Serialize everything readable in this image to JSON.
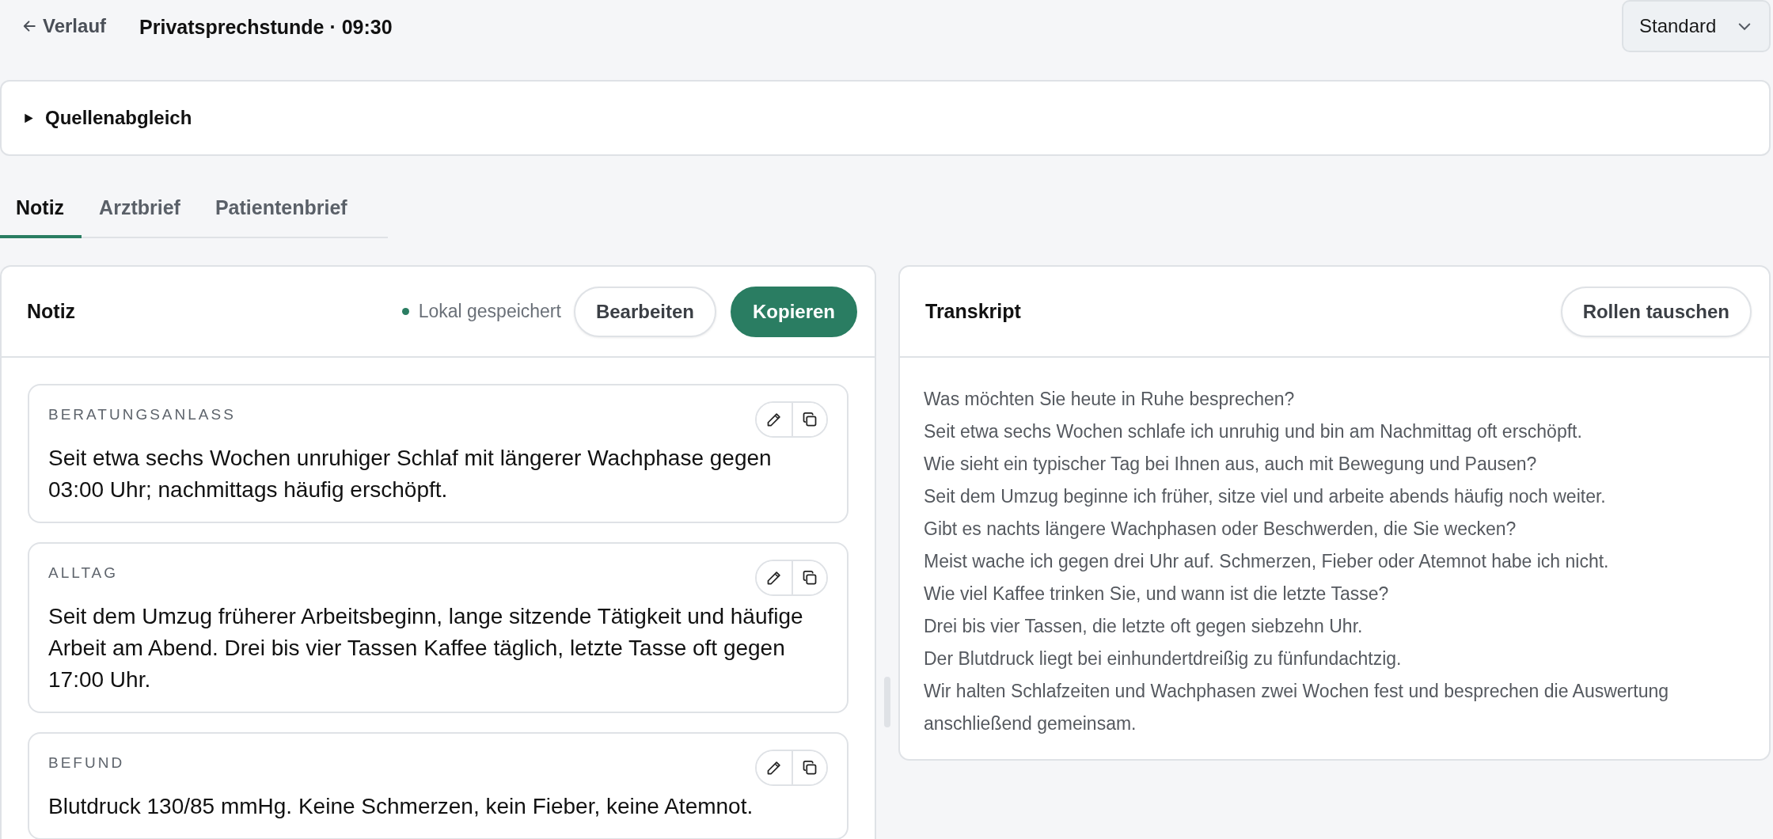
{
  "header": {
    "back_link": "Verlauf",
    "title": "Privatsprechstunde · 09:30",
    "mode_select": "Standard"
  },
  "source_check": {
    "label": "Quellenabgleich",
    "expanded": false
  },
  "tabs": [
    {
      "label": "Notiz",
      "selected": true
    },
    {
      "label": "Arztbrief",
      "selected": false
    },
    {
      "label": "Patientenbrief",
      "selected": false
    }
  ],
  "note_panel": {
    "title": "Notiz",
    "save_status": "Lokal gespeichert",
    "buttons": [
      {
        "label": "Bearbeiten",
        "kind": "secondary"
      },
      {
        "label": "Kopieren",
        "kind": "primary"
      }
    ],
    "sections": [
      {
        "heading": "BERATUNGSANLASS",
        "text": "Seit etwa sechs Wochen unruhiger Schlaf mit längerer Wachphase gegen 03:00 Uhr; nachmittags häufig erschöpft."
      },
      {
        "heading": "ALLTAG",
        "text": "Seit dem Umzug früherer Arbeitsbeginn, lange sitzende Tätigkeit und häufige Arbeit am Abend. Drei bis vier Tassen Kaffee täglich, letzte Tasse oft gegen 17:00 Uhr."
      },
      {
        "heading": "BEFUND",
        "text": "Blutdruck 130/85 mmHg. Keine Schmerzen, kein Fieber, keine Atemnot."
      }
    ]
  },
  "transcript_panel": {
    "title": "Transkript",
    "button": "Rollen tauschen",
    "lines": [
      "Was möchten Sie heute in Ruhe besprechen?",
      "Seit etwa sechs Wochen schlafe ich unruhig und bin am Nachmittag oft erschöpft.",
      "Wie sieht ein typischer Tag bei Ihnen aus, auch mit Bewegung und Pausen?",
      "Seit dem Umzug beginne ich früher, sitze viel und arbeite abends häufig noch weiter.",
      "Gibt es nachts längere Wachphasen oder Beschwerden, die Sie wecken?",
      "Meist wache ich gegen drei Uhr auf. Schmerzen, Fieber oder Atemnot habe ich nicht.",
      "Wie viel Kaffee trinken Sie, und wann ist die letzte Tasse?",
      "Drei bis vier Tassen, die letzte oft gegen siebzehn Uhr.",
      "Der Blutdruck liegt bei einhundertdreißig zu fünfundachtzig.",
      "Wir halten Schlafzeiten und Wachphasen zwei Wochen fest und besprechen die Auswertung anschließend gemeinsam."
    ]
  }
}
